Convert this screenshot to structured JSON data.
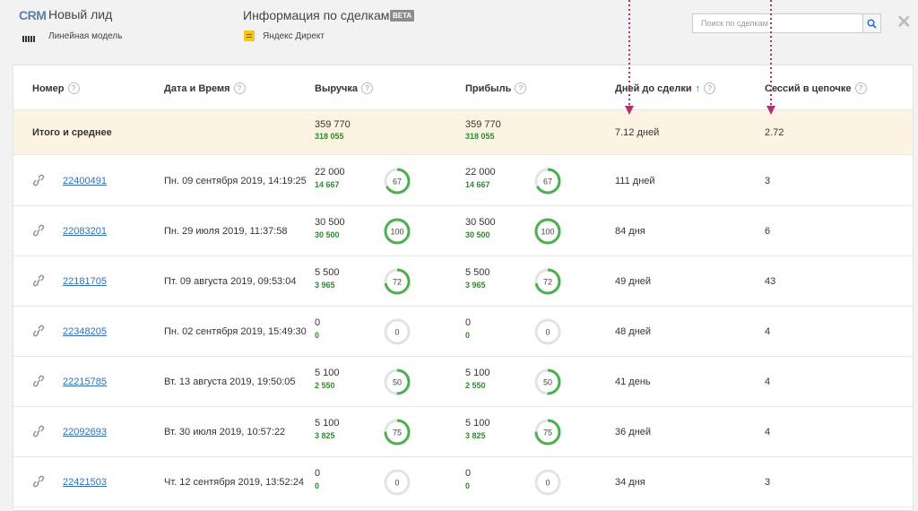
{
  "header": {
    "logo": "CRM",
    "lead_title": "Новый лид",
    "model_label": "Линейная модель",
    "deals_title": "Информация по сделкам",
    "beta_badge": "BETA",
    "source_label": "Яндекс Директ",
    "search_placeholder": "Поиск по сделкам",
    "icons": {
      "model": "bars-icon",
      "source": "yandex-direct-icon",
      "search": "search-icon",
      "close": "close-icon"
    }
  },
  "table": {
    "columns": [
      {
        "label": "Номер"
      },
      {
        "label": "Дата и Время"
      },
      {
        "label": "Выручка"
      },
      {
        "label": "Прибыль"
      },
      {
        "label": "Дней до сделки"
      },
      {
        "label": "Сессий в цепочке"
      }
    ],
    "sort_indicator": "↑",
    "help_glyph": "?",
    "totals": {
      "label": "Итого и среднее",
      "revenue": "359 770",
      "revenue_sub": "318 055",
      "profit": "359 770",
      "profit_sub": "318 055",
      "days": "7.12 дней",
      "sessions": "2.72"
    },
    "rows": [
      {
        "id": "22400491",
        "date": "Пн. 09 сентября 2019, 14:19:25",
        "revenue": "22 000",
        "revenue_sub": "14 667",
        "revenue_pct": "67",
        "profit": "22 000",
        "profit_sub": "14 667",
        "profit_pct": "67",
        "days": "111 дней",
        "sessions": "3"
      },
      {
        "id": "22083201",
        "date": "Пн. 29 июля 2019, 11:37:58",
        "revenue": "30 500",
        "revenue_sub": "30 500",
        "revenue_pct": "100",
        "profit": "30 500",
        "profit_sub": "30 500",
        "profit_pct": "100",
        "days": "84 дня",
        "sessions": "6"
      },
      {
        "id": "22181705",
        "date": "Пт. 09 августа 2019, 09:53:04",
        "revenue": "5 500",
        "revenue_sub": "3 965",
        "revenue_pct": "72",
        "profit": "5 500",
        "profit_sub": "3 965",
        "profit_pct": "72",
        "days": "49 дней",
        "sessions": "43"
      },
      {
        "id": "22348205",
        "date": "Пн. 02 сентября 2019, 15:49:30",
        "revenue": "0",
        "revenue_sub": "0",
        "revenue_pct": "0",
        "profit": "0",
        "profit_sub": "0",
        "profit_pct": "0",
        "days": "48 дней",
        "sessions": "4"
      },
      {
        "id": "22215785",
        "date": "Вт. 13 августа 2019, 19:50:05",
        "revenue": "5 100",
        "revenue_sub": "2 550",
        "revenue_pct": "50",
        "profit": "5 100",
        "profit_sub": "2 550",
        "profit_pct": "50",
        "days": "41 день",
        "sessions": "4"
      },
      {
        "id": "22092693",
        "date": "Вт. 30 июля 2019, 10:57:22",
        "revenue": "5 100",
        "revenue_sub": "3 825",
        "revenue_pct": "75",
        "profit": "5 100",
        "profit_sub": "3 825",
        "profit_pct": "75",
        "days": "36 дней",
        "sessions": "4"
      },
      {
        "id": "22421503",
        "date": "Чт. 12 сентября 2019, 13:52:24",
        "revenue": "0",
        "revenue_sub": "0",
        "revenue_pct": "0",
        "profit": "0",
        "profit_sub": "0",
        "profit_pct": "0",
        "days": "34 дня",
        "sessions": "3"
      }
    ]
  },
  "colors": {
    "accent_blue": "#2f6fb5",
    "positive_green": "#2f8a2f",
    "donut_green": "#4caf50",
    "donut_track": "#e3e3e3",
    "total_row_bg": "#fdf3e2",
    "annotation_magenta": "#b0306f"
  }
}
